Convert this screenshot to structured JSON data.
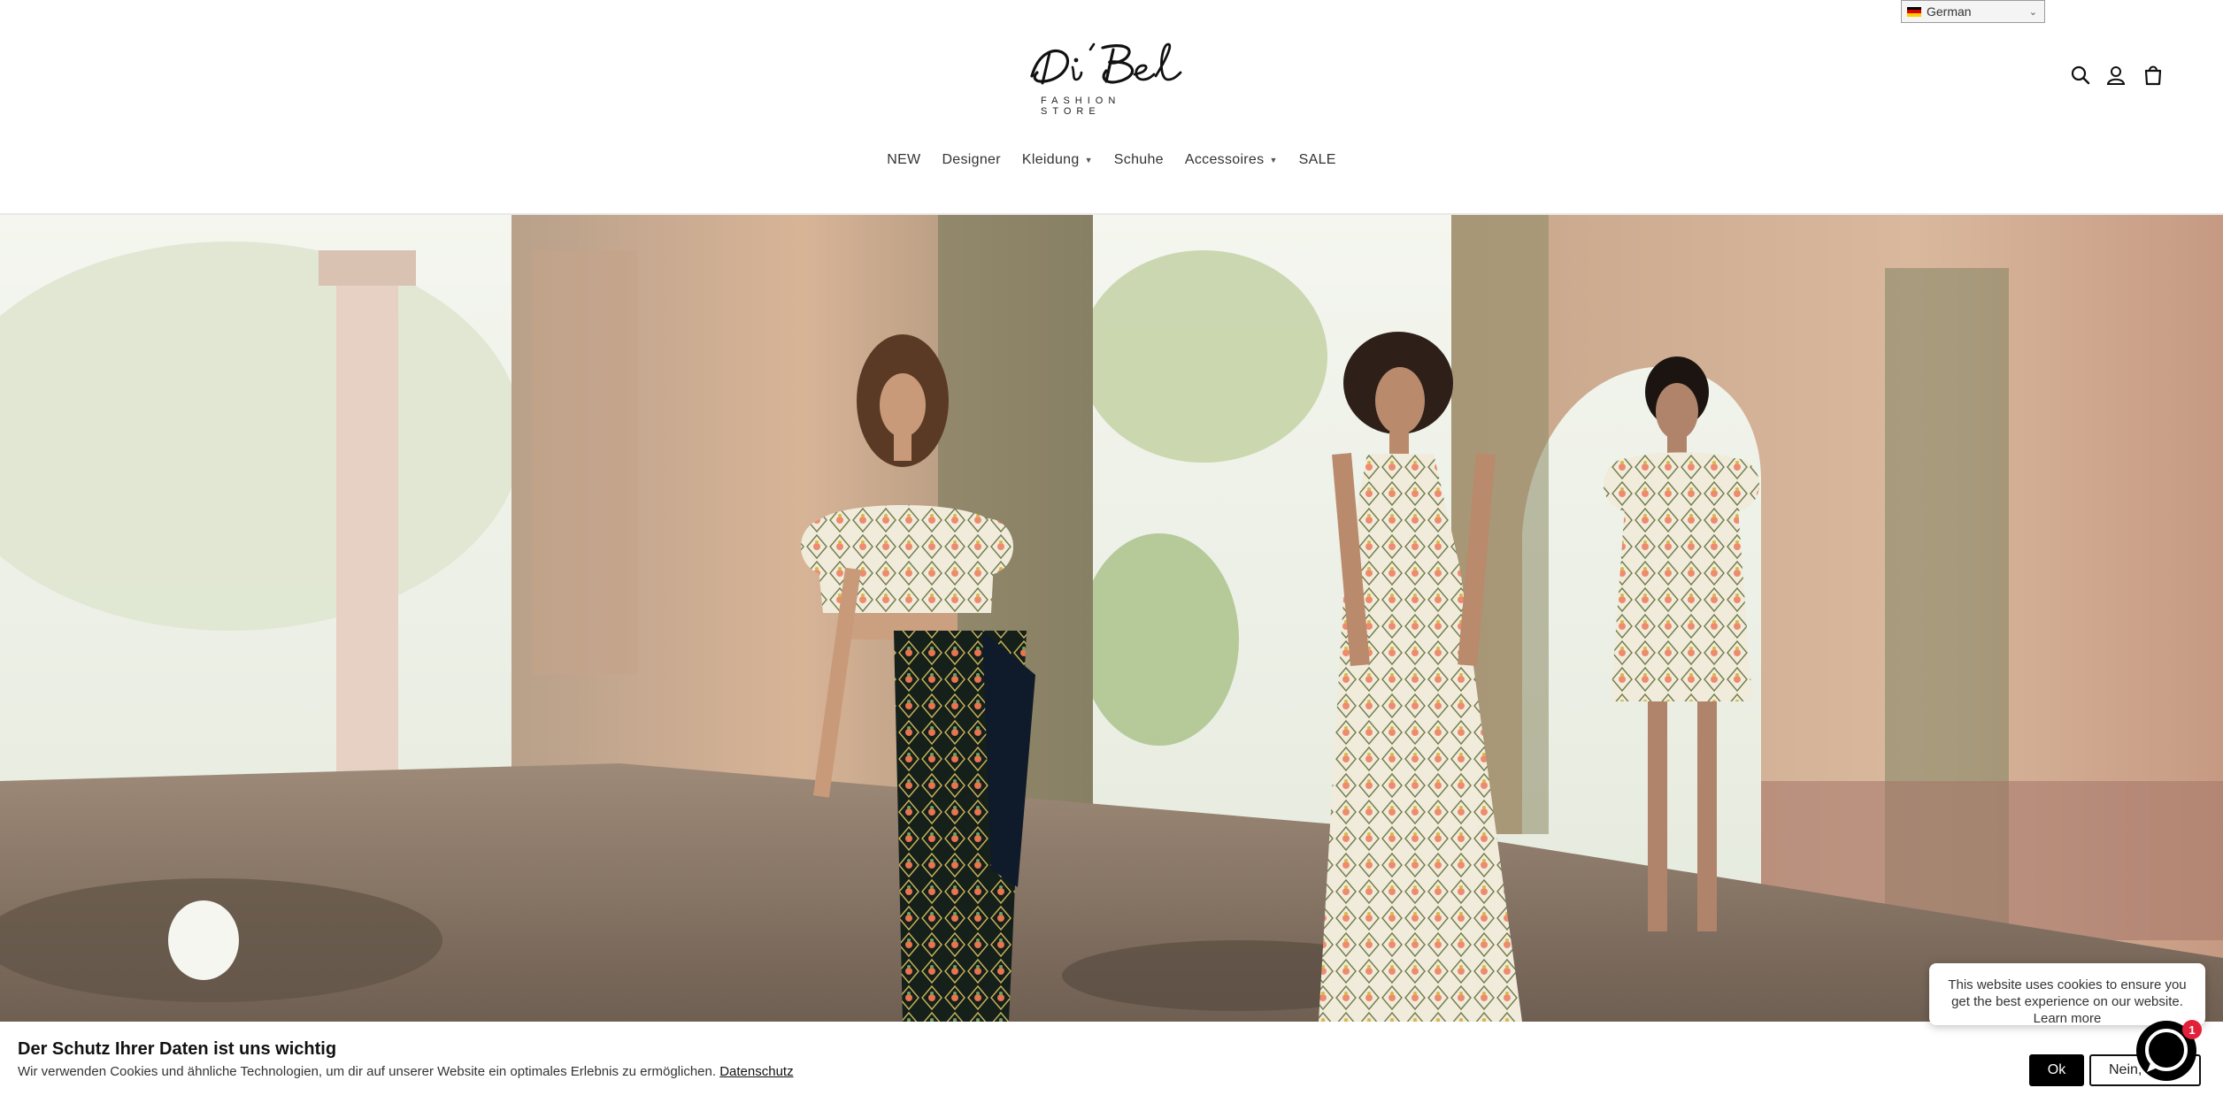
{
  "header": {
    "language": {
      "selected": "German",
      "flag_colors": [
        "#000000",
        "#dd0000",
        "#ffce00"
      ]
    },
    "logo": {
      "script_text": "Di'Bel",
      "tagline": "FASHION STORE"
    },
    "icons": [
      "search-icon",
      "account-icon",
      "cart-icon"
    ]
  },
  "nav": {
    "items": [
      {
        "label": "NEW",
        "has_dropdown": false
      },
      {
        "label": "Designer",
        "has_dropdown": false
      },
      {
        "label": "Kleidung",
        "has_dropdown": true
      },
      {
        "label": "Schuhe",
        "has_dropdown": false
      },
      {
        "label": "Accessoires",
        "has_dropdown": true
      },
      {
        "label": "SALE",
        "has_dropdown": false
      }
    ]
  },
  "hero": {
    "image_alt": "Three models in floral dresses in a ruined stone building"
  },
  "cookie_bar": {
    "title": "Der Schutz Ihrer Daten ist uns wichtig",
    "text": "Wir verwenden Cookies und ähnliche Technologien, um dir auf unserer Website ein optimales Erlebnis zu ermöglichen.",
    "link": "Datenschutz",
    "ok_label": "Ok",
    "decline_label": "Nein, danke"
  },
  "chat": {
    "message": "This website uses cookies to ensure you get the best experience on our website.",
    "learn_more": "Learn more",
    "badge_count": "1"
  },
  "colors": {
    "text": "#121212",
    "nav_text": "#333333",
    "button_dark": "#000000",
    "badge": "#e2203a",
    "divider": "#e9e9e9"
  }
}
